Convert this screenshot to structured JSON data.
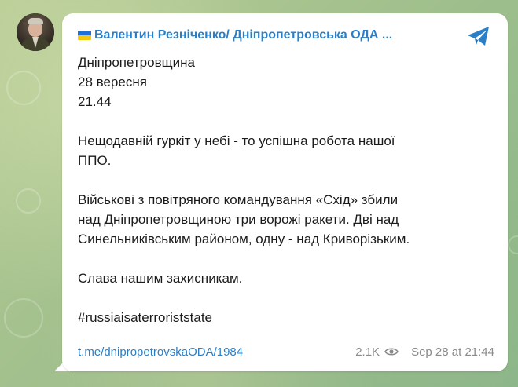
{
  "post": {
    "channel_name": "Валентин Резніченко/ Дніпропетровська ОДА ...",
    "flag_icon": "ukraine-flag-icon",
    "share_icon": "telegram-plane-icon",
    "accent_color": "#2a7fc7",
    "lines": {
      "l1": "Дніпропетровщина",
      "l2": "28 вересня",
      "l3": "21.44",
      "l4": "Нещодавній гуркіт у небі - то успішна робота нашої",
      "l5": "ППО.",
      "l6": "Військові з повітряного командування «Схід» збили",
      "l7": "над Дніпропетровщиною три ворожі ракети. Дві над",
      "l8": "Синельниківським районом, одну - над Криворізьким.",
      "l9": "Слава нашим захисникам.",
      "l10": "#russiaisaterroriststate"
    },
    "link": "t.me/dnipropetrovskaODA/1984",
    "views": "2.1K",
    "timestamp": "Sep 28 at 21:44"
  }
}
